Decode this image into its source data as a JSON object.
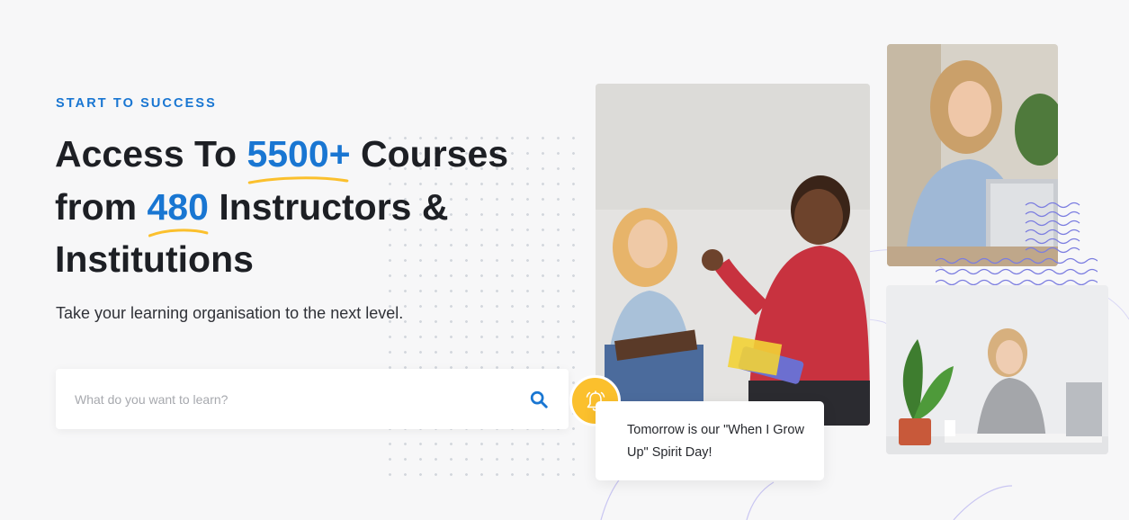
{
  "hero": {
    "eyebrow": "START TO SUCCESS",
    "headline": {
      "part1": "Access To ",
      "highlight1": "5500+",
      "part2": " Courses from ",
      "highlight2": "480",
      "part3": " Instructors & Institutions"
    },
    "subtitle": "Take your learning organisation to the next level."
  },
  "search": {
    "placeholder": "What do you want to learn?",
    "icon": "search-icon"
  },
  "notification": {
    "icon": "bell-icon",
    "text": "Tomorrow is our \"When I Grow Up\" Spirit Day!"
  },
  "colors": {
    "accent": "#1976d2",
    "highlight_underline": "#fbc02d",
    "bell_badge": "#fbc02d",
    "text_dark": "#1d1f24",
    "background": "#f7f7f8"
  }
}
